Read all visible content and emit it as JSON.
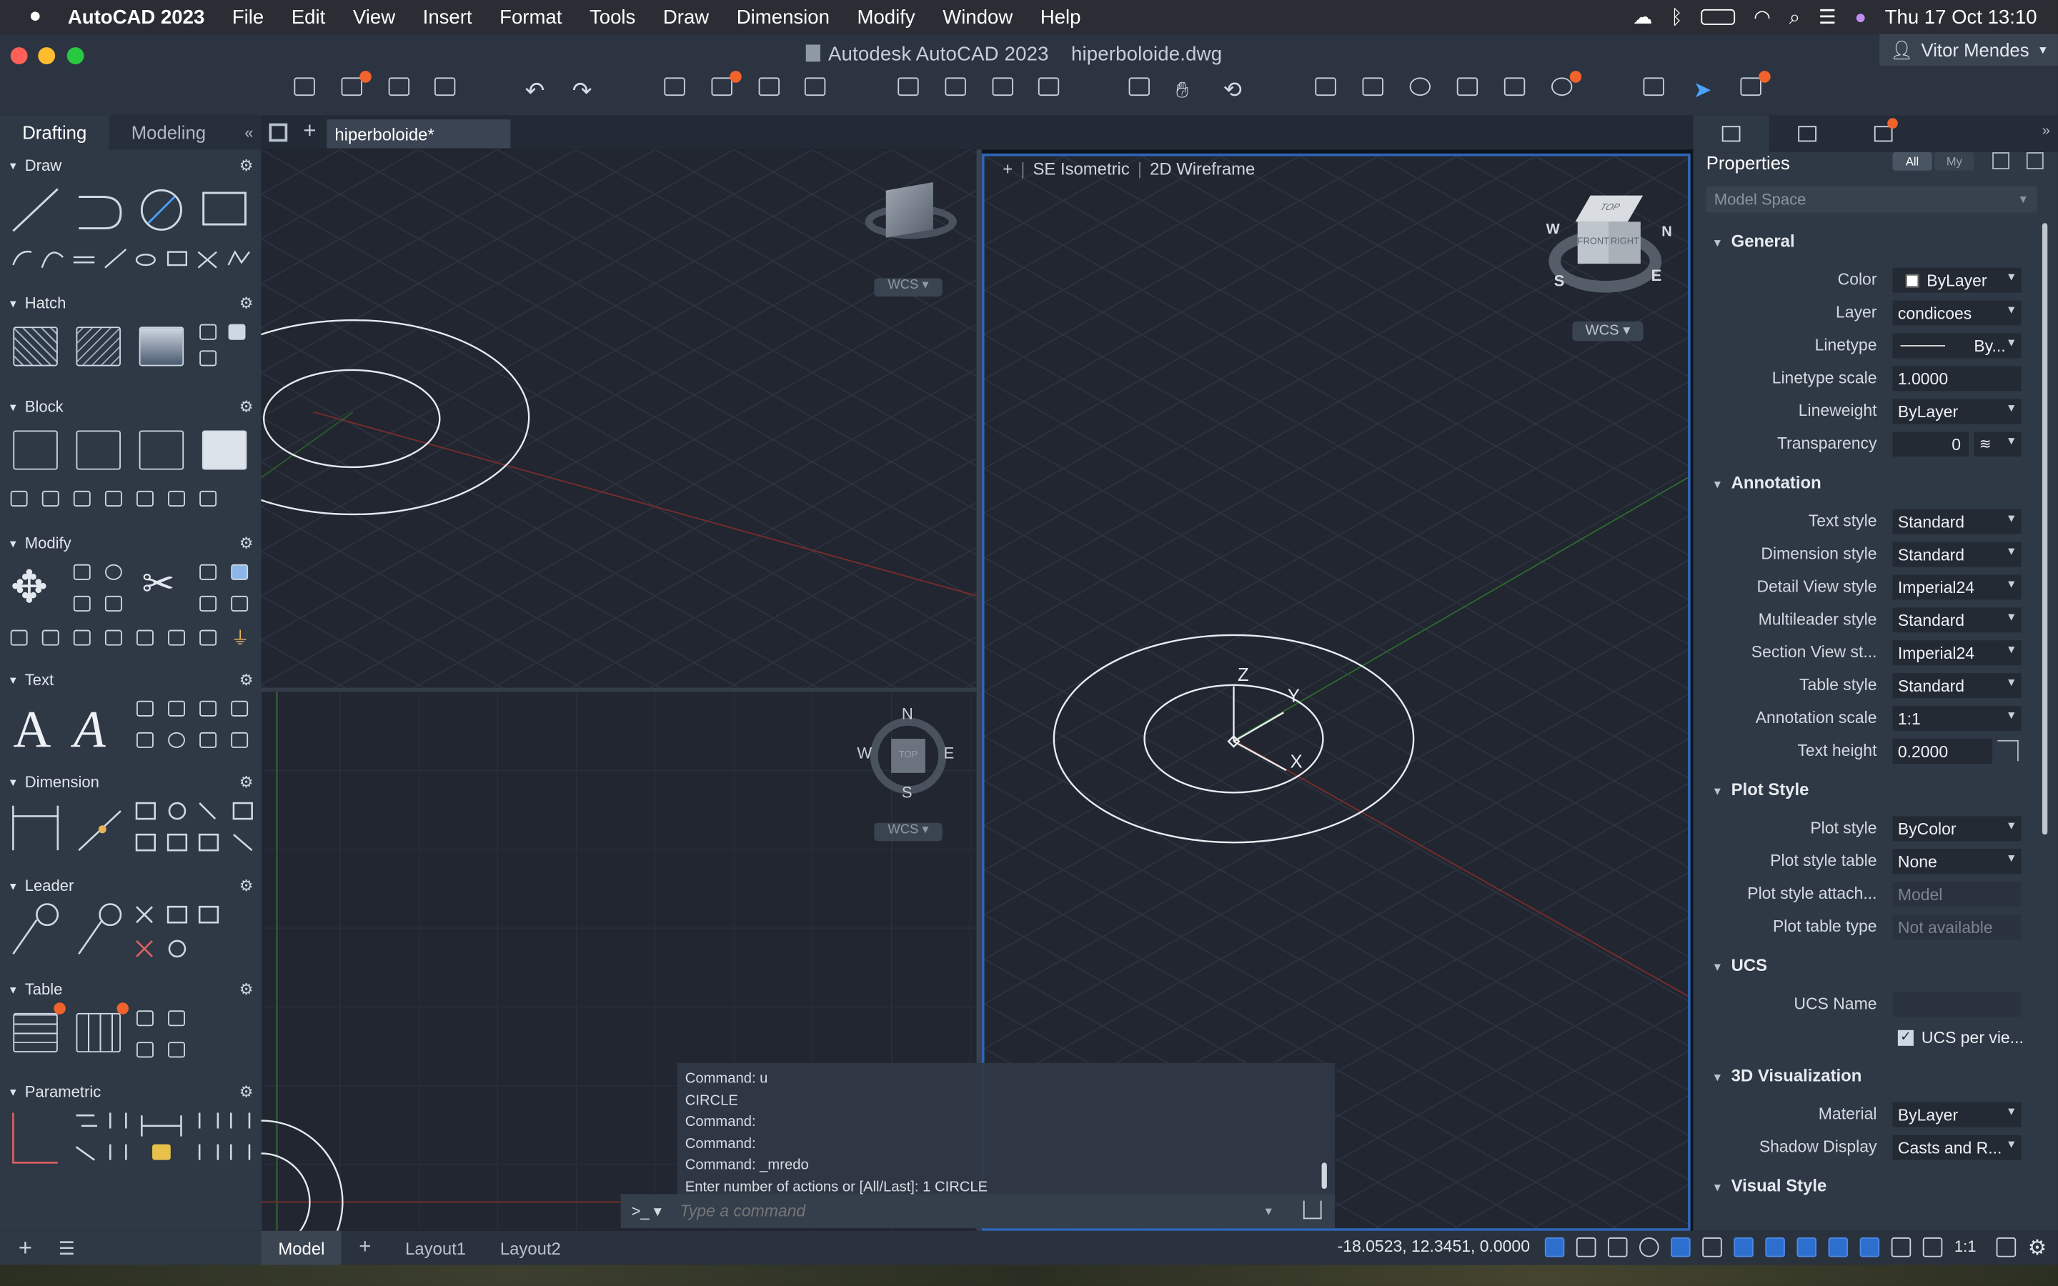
{
  "menubar": {
    "app": "AutoCAD 2023",
    "items": [
      "File",
      "Edit",
      "View",
      "Insert",
      "Format",
      "Tools",
      "Draw",
      "Dimension",
      "Modify",
      "Window",
      "Help"
    ],
    "datetime": "Thu 17 Oct  13:10"
  },
  "window": {
    "app_title": "Autodesk AutoCAD 2023",
    "file_name": "hiperboloide.dwg",
    "user": "Vitor Mendes"
  },
  "palette": {
    "tabs": [
      "Drafting",
      "Modeling"
    ],
    "sections": [
      "Draw",
      "Hatch",
      "Block",
      "Modify",
      "Text",
      "Dimension",
      "Leader",
      "Table",
      "Parametric"
    ]
  },
  "doc": {
    "tab": "hiperboloide*"
  },
  "viewport": {
    "view": "SE Isometric",
    "style": "2D Wireframe",
    "plus": "+",
    "wcs": "WCS",
    "axis": {
      "x": "X",
      "y": "Y",
      "z": "Z"
    },
    "compass": {
      "n": "N",
      "s": "S",
      "e": "E",
      "w": "W",
      "top": "TOP"
    },
    "cube": {
      "top": "TOP",
      "front": "FRONT",
      "right": "RIGHT"
    }
  },
  "command": {
    "history": [
      "Command: u",
      "CIRCLE",
      "Command:",
      "Command:",
      "Command: _mredo",
      "Enter number of actions or [All/Last]: 1 CIRCLE"
    ],
    "prompt": ">_",
    "placeholder": "Type a command"
  },
  "properties": {
    "title": "Properties",
    "filter_all": "All",
    "filter_my": "My",
    "scope": "Model Space",
    "groups": {
      "general": "General",
      "annotation": "Annotation",
      "plot": "Plot Style",
      "ucs": "UCS",
      "viz": "3D Visualization",
      "visual": "Visual Style"
    },
    "general": [
      {
        "l": "Color",
        "v": "ByLayer"
      },
      {
        "l": "Layer",
        "v": "condicoes"
      },
      {
        "l": "Linetype",
        "v": "By..."
      },
      {
        "l": "Linetype scale",
        "v": "1.0000"
      },
      {
        "l": "Lineweight",
        "v": "ByLayer"
      },
      {
        "l": "Transparency",
        "v": "0"
      }
    ],
    "annotation": [
      {
        "l": "Text style",
        "v": "Standard"
      },
      {
        "l": "Dimension style",
        "v": "Standard"
      },
      {
        "l": "Detail View style",
        "v": "Imperial24"
      },
      {
        "l": "Multileader style",
        "v": "Standard"
      },
      {
        "l": "Section View st...",
        "v": "Imperial24"
      },
      {
        "l": "Table style",
        "v": "Standard"
      },
      {
        "l": "Annotation scale",
        "v": "1:1"
      },
      {
        "l": "Text height",
        "v": "0.2000"
      }
    ],
    "plot": [
      {
        "l": "Plot style",
        "v": "ByColor"
      },
      {
        "l": "Plot style table",
        "v": "None"
      },
      {
        "l": "Plot style attach...",
        "v": "Model"
      },
      {
        "l": "Plot table type",
        "v": "Not available"
      }
    ],
    "ucs": [
      {
        "l": "UCS Name",
        "v": ""
      },
      {
        "l": "",
        "v": "UCS per vie..."
      }
    ],
    "viz": [
      {
        "l": "Material",
        "v": "ByLayer"
      },
      {
        "l": "Shadow Display",
        "v": "Casts and R..."
      }
    ]
  },
  "status": {
    "layouts": [
      "Model",
      "+",
      "Layout1",
      "Layout2"
    ],
    "coords": "-18.0523, 12.3451, 0.0000",
    "scale": "1:1"
  }
}
